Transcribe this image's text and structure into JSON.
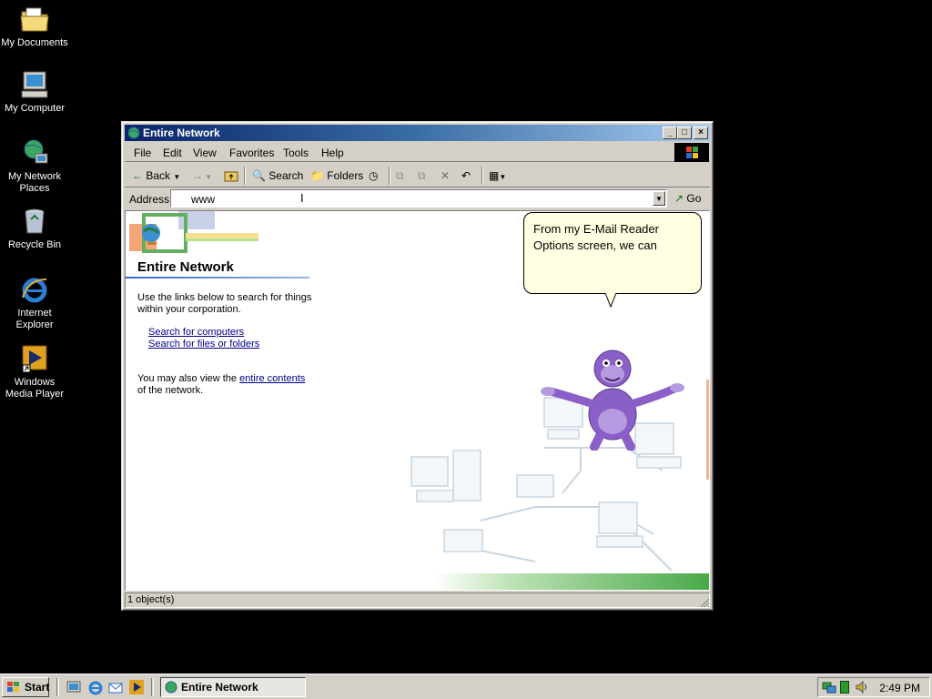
{
  "desktop": {
    "icons": [
      {
        "label": "My Documents",
        "icon": "folder-documents-icon"
      },
      {
        "label": "My Computer",
        "icon": "computer-icon"
      },
      {
        "label": "My Network Places",
        "icon": "network-places-icon"
      },
      {
        "label": "Recycle Bin",
        "icon": "recycle-bin-icon"
      },
      {
        "label": "Internet Explorer",
        "icon": "internet-explorer-icon"
      },
      {
        "label": "Windows Media Player",
        "icon": "media-player-icon"
      }
    ]
  },
  "window": {
    "title": "Entire Network",
    "controls": {
      "minimize": "_",
      "maximize": "□",
      "close": "×"
    },
    "menu": [
      "File",
      "Edit",
      "View",
      "Favorites",
      "Tools",
      "Help"
    ],
    "toolbar": {
      "back": "Back",
      "search": "Search",
      "folders": "Folders"
    },
    "address": {
      "label": "Address",
      "value": "www",
      "go": "Go"
    },
    "content": {
      "heading": "Entire Network",
      "intro_line1": "Use the links below to search for things",
      "intro_line2": "within your corporation.",
      "link_computers": "Search for computers",
      "link_files": "Search for files or folders",
      "view_prefix": "You may also view the ",
      "view_link": "entire contents",
      "view_suffix": "of the network."
    },
    "balloon": {
      "line1": "From my E-Mail Reader",
      "line2": "Options screen, we can"
    },
    "status": "1 object(s)"
  },
  "taskbar": {
    "start": "Start",
    "task": "Entire Network",
    "clock": "2:49 PM"
  },
  "colors": {
    "desktop": "#000000",
    "titlebar_start": "#0a246a",
    "titlebar_end": "#a6caf0",
    "link": "#00008b",
    "balloon": "#ffffe1",
    "bonzi": "#8a5fc7"
  }
}
